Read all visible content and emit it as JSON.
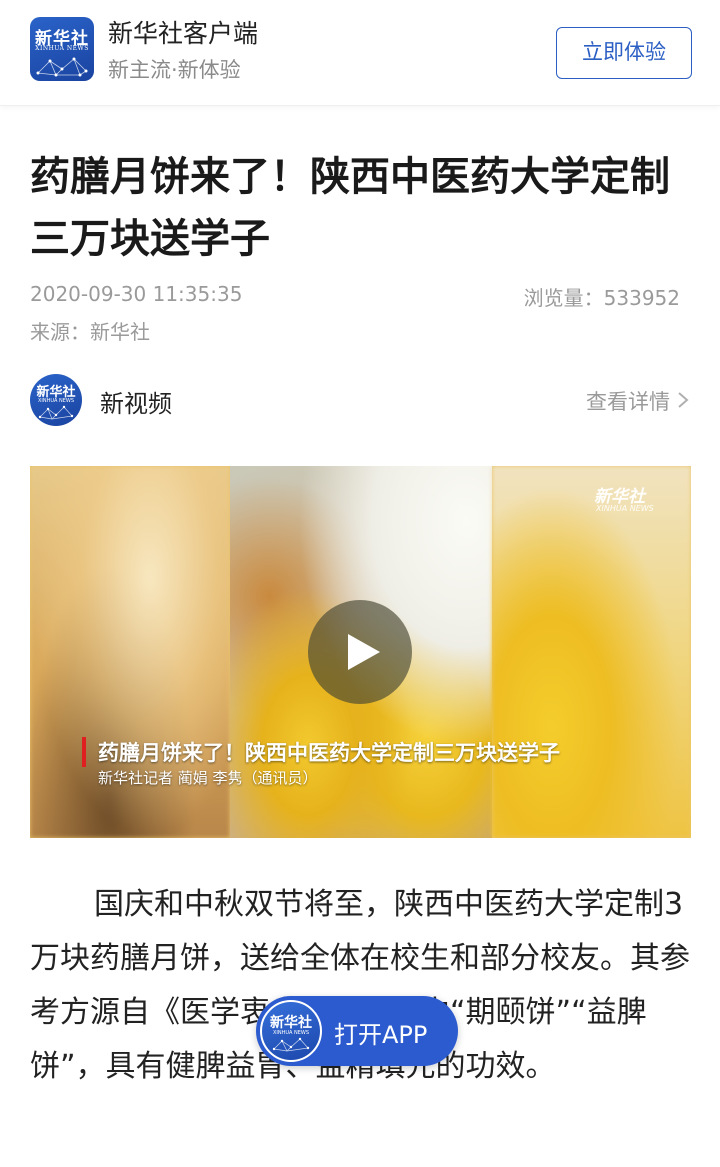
{
  "app_banner": {
    "logo_text": "新华社",
    "logo_subtext": "XINHUA NEWS",
    "app_name": "新华社客户端",
    "slogan": "新主流·新体验",
    "try_button": "立即体验"
  },
  "article": {
    "title": "药膳月饼来了！陕西中医药大学定制三万块送学子",
    "date": "2020-09-30 11:35:35",
    "views": "浏览量：533952",
    "source": "来源：新华社"
  },
  "channel": {
    "avatar_text": "新华社",
    "avatar_subtext": "XINHUA NEWS",
    "name": "新视频",
    "details_link": "查看详情"
  },
  "video": {
    "watermark": "新华社",
    "watermark_sub": "XINHUA NEWS",
    "caption": "药膳月饼来了！陕西中医药大学定制三万块送学子",
    "byline": "新华社记者 蔺娟 李隽（通讯员）"
  },
  "body": {
    "paragraph": "国庆和中秋双节将至，陕西中医药大学定制3万块药膳月饼，送给全体在校生和部分校友。其参考方源自《医学衷中参西录》中“期颐饼”“益脾饼”，具有健脾益胃、益精填元的功效。"
  },
  "open_app": {
    "logo_text": "新华社",
    "logo_subtext": "XINHUA NEWS",
    "label": "打开APP"
  },
  "colors": {
    "brand_blue": "#2c5fc4",
    "caption_red": "#e02020"
  }
}
